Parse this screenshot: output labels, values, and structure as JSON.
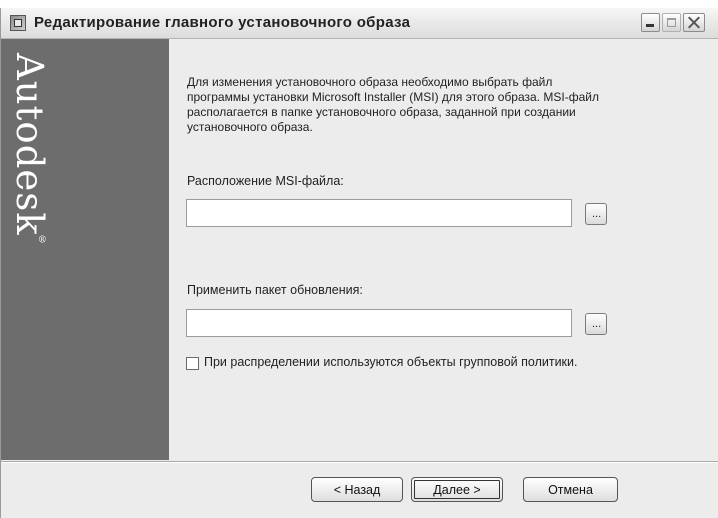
{
  "window": {
    "title": "Редактирование главного установочного образа"
  },
  "sidebar": {
    "brand": "Autodesk",
    "brand_mark": "®"
  },
  "main": {
    "description": "Для изменения установочного образа необходимо выбрать файл программы установки Microsoft Installer (MSI) для этого образа.  MSI-файл располагается в папке установочного образа, заданной при создании установочного образа.",
    "msi_label": "Расположение MSI-файла:",
    "msi_value": "",
    "browse_label": "...",
    "patch_label": "Применить пакет обновления:",
    "patch_value": "",
    "gpo_checkbox_label": "При распределении используются объекты групповой политики.",
    "gpo_checked": false
  },
  "footer": {
    "back_label": "< Назад",
    "next_label": "Далее >",
    "cancel_label": "Отмена"
  },
  "colors": {
    "sidebar": "#6d6d6d",
    "window_bg": "#ececec"
  }
}
